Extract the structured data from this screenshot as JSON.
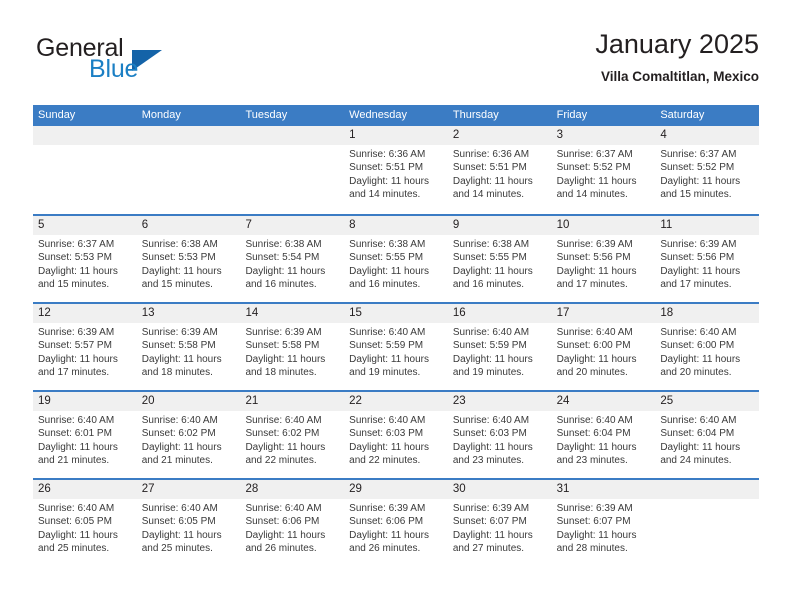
{
  "brand": {
    "word_one": "General",
    "word_two": "Blue",
    "logo_icon": "triangle-logo-icon"
  },
  "header": {
    "title": "January 2025",
    "subtitle": "Villa Comaltitlan, Mexico"
  },
  "theme": {
    "header_blue": "#3b7cc4",
    "brand_blue": "#1b7fc4",
    "logo_blue": "#1463a8",
    "date_band": "#f0f0f0",
    "text": "#231f20"
  },
  "weekdays": [
    "Sunday",
    "Monday",
    "Tuesday",
    "Wednesday",
    "Thursday",
    "Friday",
    "Saturday"
  ],
  "labels": {
    "sunrise": "Sunrise:",
    "sunset": "Sunset:",
    "daylight": "Daylight:"
  },
  "weeks": [
    [
      {
        "day": "",
        "sunrise": "",
        "sunset": "",
        "daylight_a": "",
        "daylight_b": ""
      },
      {
        "day": "",
        "sunrise": "",
        "sunset": "",
        "daylight_a": "",
        "daylight_b": ""
      },
      {
        "day": "",
        "sunrise": "",
        "sunset": "",
        "daylight_a": "",
        "daylight_b": ""
      },
      {
        "day": "1",
        "sunrise": "Sunrise: 6:36 AM",
        "sunset": "Sunset: 5:51 PM",
        "daylight_a": "Daylight: 11 hours",
        "daylight_b": "and 14 minutes."
      },
      {
        "day": "2",
        "sunrise": "Sunrise: 6:36 AM",
        "sunset": "Sunset: 5:51 PM",
        "daylight_a": "Daylight: 11 hours",
        "daylight_b": "and 14 minutes."
      },
      {
        "day": "3",
        "sunrise": "Sunrise: 6:37 AM",
        "sunset": "Sunset: 5:52 PM",
        "daylight_a": "Daylight: 11 hours",
        "daylight_b": "and 14 minutes."
      },
      {
        "day": "4",
        "sunrise": "Sunrise: 6:37 AM",
        "sunset": "Sunset: 5:52 PM",
        "daylight_a": "Daylight: 11 hours",
        "daylight_b": "and 15 minutes."
      }
    ],
    [
      {
        "day": "5",
        "sunrise": "Sunrise: 6:37 AM",
        "sunset": "Sunset: 5:53 PM",
        "daylight_a": "Daylight: 11 hours",
        "daylight_b": "and 15 minutes."
      },
      {
        "day": "6",
        "sunrise": "Sunrise: 6:38 AM",
        "sunset": "Sunset: 5:53 PM",
        "daylight_a": "Daylight: 11 hours",
        "daylight_b": "and 15 minutes."
      },
      {
        "day": "7",
        "sunrise": "Sunrise: 6:38 AM",
        "sunset": "Sunset: 5:54 PM",
        "daylight_a": "Daylight: 11 hours",
        "daylight_b": "and 16 minutes."
      },
      {
        "day": "8",
        "sunrise": "Sunrise: 6:38 AM",
        "sunset": "Sunset: 5:55 PM",
        "daylight_a": "Daylight: 11 hours",
        "daylight_b": "and 16 minutes."
      },
      {
        "day": "9",
        "sunrise": "Sunrise: 6:38 AM",
        "sunset": "Sunset: 5:55 PM",
        "daylight_a": "Daylight: 11 hours",
        "daylight_b": "and 16 minutes."
      },
      {
        "day": "10",
        "sunrise": "Sunrise: 6:39 AM",
        "sunset": "Sunset: 5:56 PM",
        "daylight_a": "Daylight: 11 hours",
        "daylight_b": "and 17 minutes."
      },
      {
        "day": "11",
        "sunrise": "Sunrise: 6:39 AM",
        "sunset": "Sunset: 5:56 PM",
        "daylight_a": "Daylight: 11 hours",
        "daylight_b": "and 17 minutes."
      }
    ],
    [
      {
        "day": "12",
        "sunrise": "Sunrise: 6:39 AM",
        "sunset": "Sunset: 5:57 PM",
        "daylight_a": "Daylight: 11 hours",
        "daylight_b": "and 17 minutes."
      },
      {
        "day": "13",
        "sunrise": "Sunrise: 6:39 AM",
        "sunset": "Sunset: 5:58 PM",
        "daylight_a": "Daylight: 11 hours",
        "daylight_b": "and 18 minutes."
      },
      {
        "day": "14",
        "sunrise": "Sunrise: 6:39 AM",
        "sunset": "Sunset: 5:58 PM",
        "daylight_a": "Daylight: 11 hours",
        "daylight_b": "and 18 minutes."
      },
      {
        "day": "15",
        "sunrise": "Sunrise: 6:40 AM",
        "sunset": "Sunset: 5:59 PM",
        "daylight_a": "Daylight: 11 hours",
        "daylight_b": "and 19 minutes."
      },
      {
        "day": "16",
        "sunrise": "Sunrise: 6:40 AM",
        "sunset": "Sunset: 5:59 PM",
        "daylight_a": "Daylight: 11 hours",
        "daylight_b": "and 19 minutes."
      },
      {
        "day": "17",
        "sunrise": "Sunrise: 6:40 AM",
        "sunset": "Sunset: 6:00 PM",
        "daylight_a": "Daylight: 11 hours",
        "daylight_b": "and 20 minutes."
      },
      {
        "day": "18",
        "sunrise": "Sunrise: 6:40 AM",
        "sunset": "Sunset: 6:00 PM",
        "daylight_a": "Daylight: 11 hours",
        "daylight_b": "and 20 minutes."
      }
    ],
    [
      {
        "day": "19",
        "sunrise": "Sunrise: 6:40 AM",
        "sunset": "Sunset: 6:01 PM",
        "daylight_a": "Daylight: 11 hours",
        "daylight_b": "and 21 minutes."
      },
      {
        "day": "20",
        "sunrise": "Sunrise: 6:40 AM",
        "sunset": "Sunset: 6:02 PM",
        "daylight_a": "Daylight: 11 hours",
        "daylight_b": "and 21 minutes."
      },
      {
        "day": "21",
        "sunrise": "Sunrise: 6:40 AM",
        "sunset": "Sunset: 6:02 PM",
        "daylight_a": "Daylight: 11 hours",
        "daylight_b": "and 22 minutes."
      },
      {
        "day": "22",
        "sunrise": "Sunrise: 6:40 AM",
        "sunset": "Sunset: 6:03 PM",
        "daylight_a": "Daylight: 11 hours",
        "daylight_b": "and 22 minutes."
      },
      {
        "day": "23",
        "sunrise": "Sunrise: 6:40 AM",
        "sunset": "Sunset: 6:03 PM",
        "daylight_a": "Daylight: 11 hours",
        "daylight_b": "and 23 minutes."
      },
      {
        "day": "24",
        "sunrise": "Sunrise: 6:40 AM",
        "sunset": "Sunset: 6:04 PM",
        "daylight_a": "Daylight: 11 hours",
        "daylight_b": "and 23 minutes."
      },
      {
        "day": "25",
        "sunrise": "Sunrise: 6:40 AM",
        "sunset": "Sunset: 6:04 PM",
        "daylight_a": "Daylight: 11 hours",
        "daylight_b": "and 24 minutes."
      }
    ],
    [
      {
        "day": "26",
        "sunrise": "Sunrise: 6:40 AM",
        "sunset": "Sunset: 6:05 PM",
        "daylight_a": "Daylight: 11 hours",
        "daylight_b": "and 25 minutes."
      },
      {
        "day": "27",
        "sunrise": "Sunrise: 6:40 AM",
        "sunset": "Sunset: 6:05 PM",
        "daylight_a": "Daylight: 11 hours",
        "daylight_b": "and 25 minutes."
      },
      {
        "day": "28",
        "sunrise": "Sunrise: 6:40 AM",
        "sunset": "Sunset: 6:06 PM",
        "daylight_a": "Daylight: 11 hours",
        "daylight_b": "and 26 minutes."
      },
      {
        "day": "29",
        "sunrise": "Sunrise: 6:39 AM",
        "sunset": "Sunset: 6:06 PM",
        "daylight_a": "Daylight: 11 hours",
        "daylight_b": "and 26 minutes."
      },
      {
        "day": "30",
        "sunrise": "Sunrise: 6:39 AM",
        "sunset": "Sunset: 6:07 PM",
        "daylight_a": "Daylight: 11 hours",
        "daylight_b": "and 27 minutes."
      },
      {
        "day": "31",
        "sunrise": "Sunrise: 6:39 AM",
        "sunset": "Sunset: 6:07 PM",
        "daylight_a": "Daylight: 11 hours",
        "daylight_b": "and 28 minutes."
      },
      {
        "day": "",
        "sunrise": "",
        "sunset": "",
        "daylight_a": "",
        "daylight_b": ""
      }
    ]
  ]
}
